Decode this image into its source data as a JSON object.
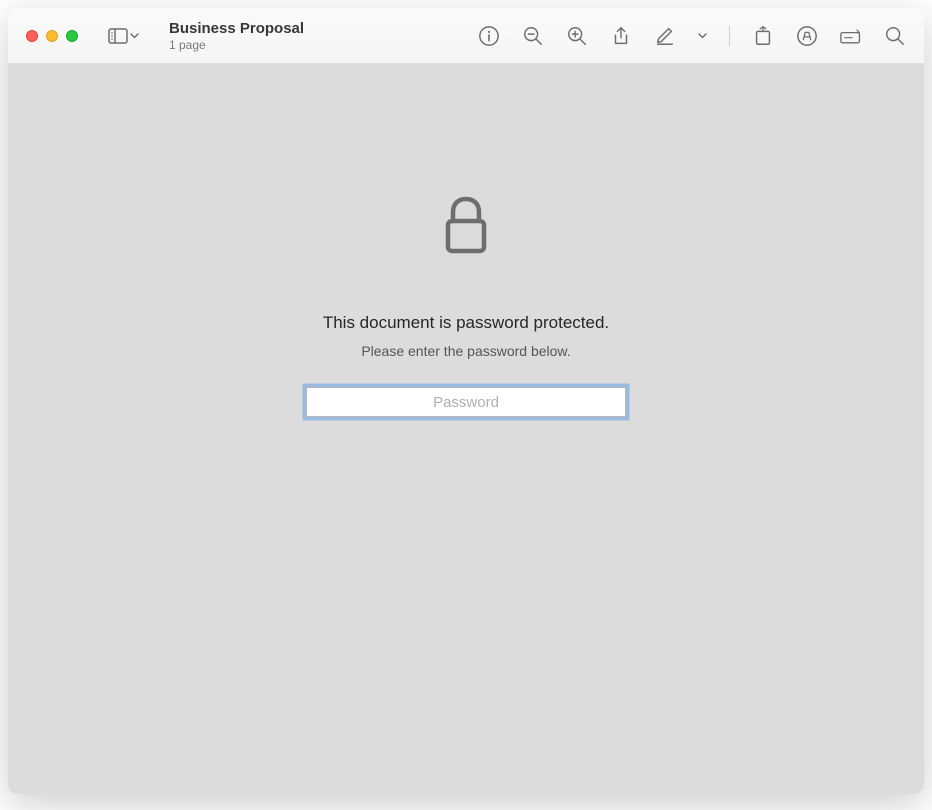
{
  "header": {
    "title": "Business Proposal",
    "subtitle": "1 page"
  },
  "content": {
    "primary_message": "This document is password protected.",
    "secondary_message": "Please enter the password below.",
    "password_placeholder": "Password"
  }
}
